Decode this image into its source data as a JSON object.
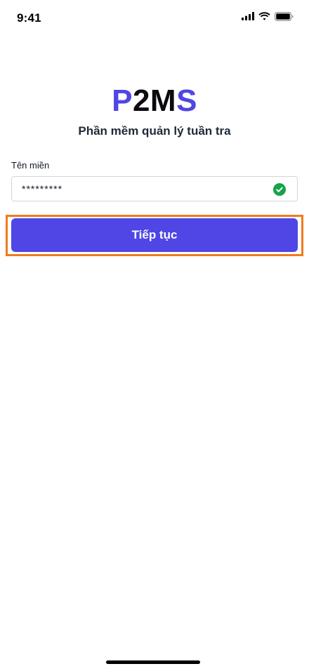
{
  "status_bar": {
    "time": "9:41",
    "icons": [
      "cellular-signal-icon",
      "wifi-icon",
      "battery-icon"
    ]
  },
  "logo": {
    "part1": "P",
    "part2": "2M",
    "part3": "S",
    "accent_color": "#4f46e5",
    "dark_color": "#0b0b0f"
  },
  "subtitle": "Phần mềm quản lý tuần tra",
  "domain_field": {
    "label": "Tên miền",
    "value": "*********",
    "status_icon": "check-circle-icon",
    "status_color": "#16a34a"
  },
  "continue_button": {
    "label": "Tiếp tục",
    "color": "#4f46e5",
    "highlight_color": "#f07a1c"
  }
}
